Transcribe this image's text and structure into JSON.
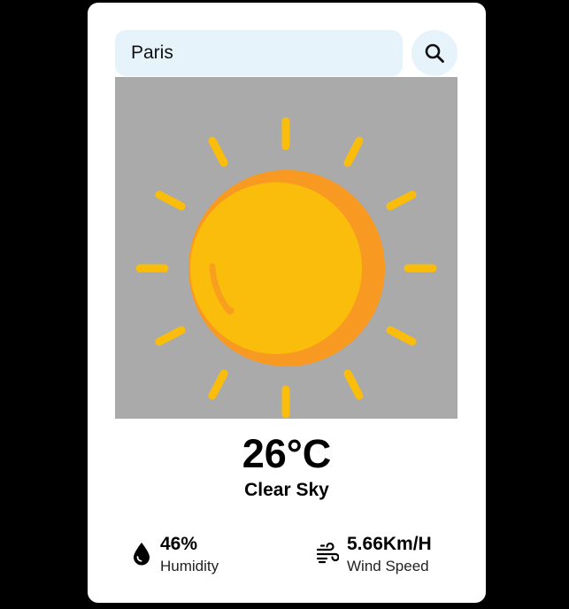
{
  "search": {
    "value": "Paris"
  },
  "weather": {
    "icon": "sun-icon",
    "temperature": "26°C",
    "condition": "Clear Sky"
  },
  "stats": {
    "humidity": {
      "value": "46%",
      "label": "Humidity",
      "icon": "water-drop-icon"
    },
    "wind": {
      "value": "5.66Km/H",
      "label": "Wind Speed",
      "icon": "wind-icon"
    }
  },
  "colors": {
    "background": "#000000",
    "card": "#ffffff",
    "search_bg": "#e6f3fb",
    "image_bg": "#aaaaaa",
    "sun_main": "#fbbd0c",
    "sun_shade": "#f89a22",
    "sun_highlight": "#f8a01e"
  }
}
